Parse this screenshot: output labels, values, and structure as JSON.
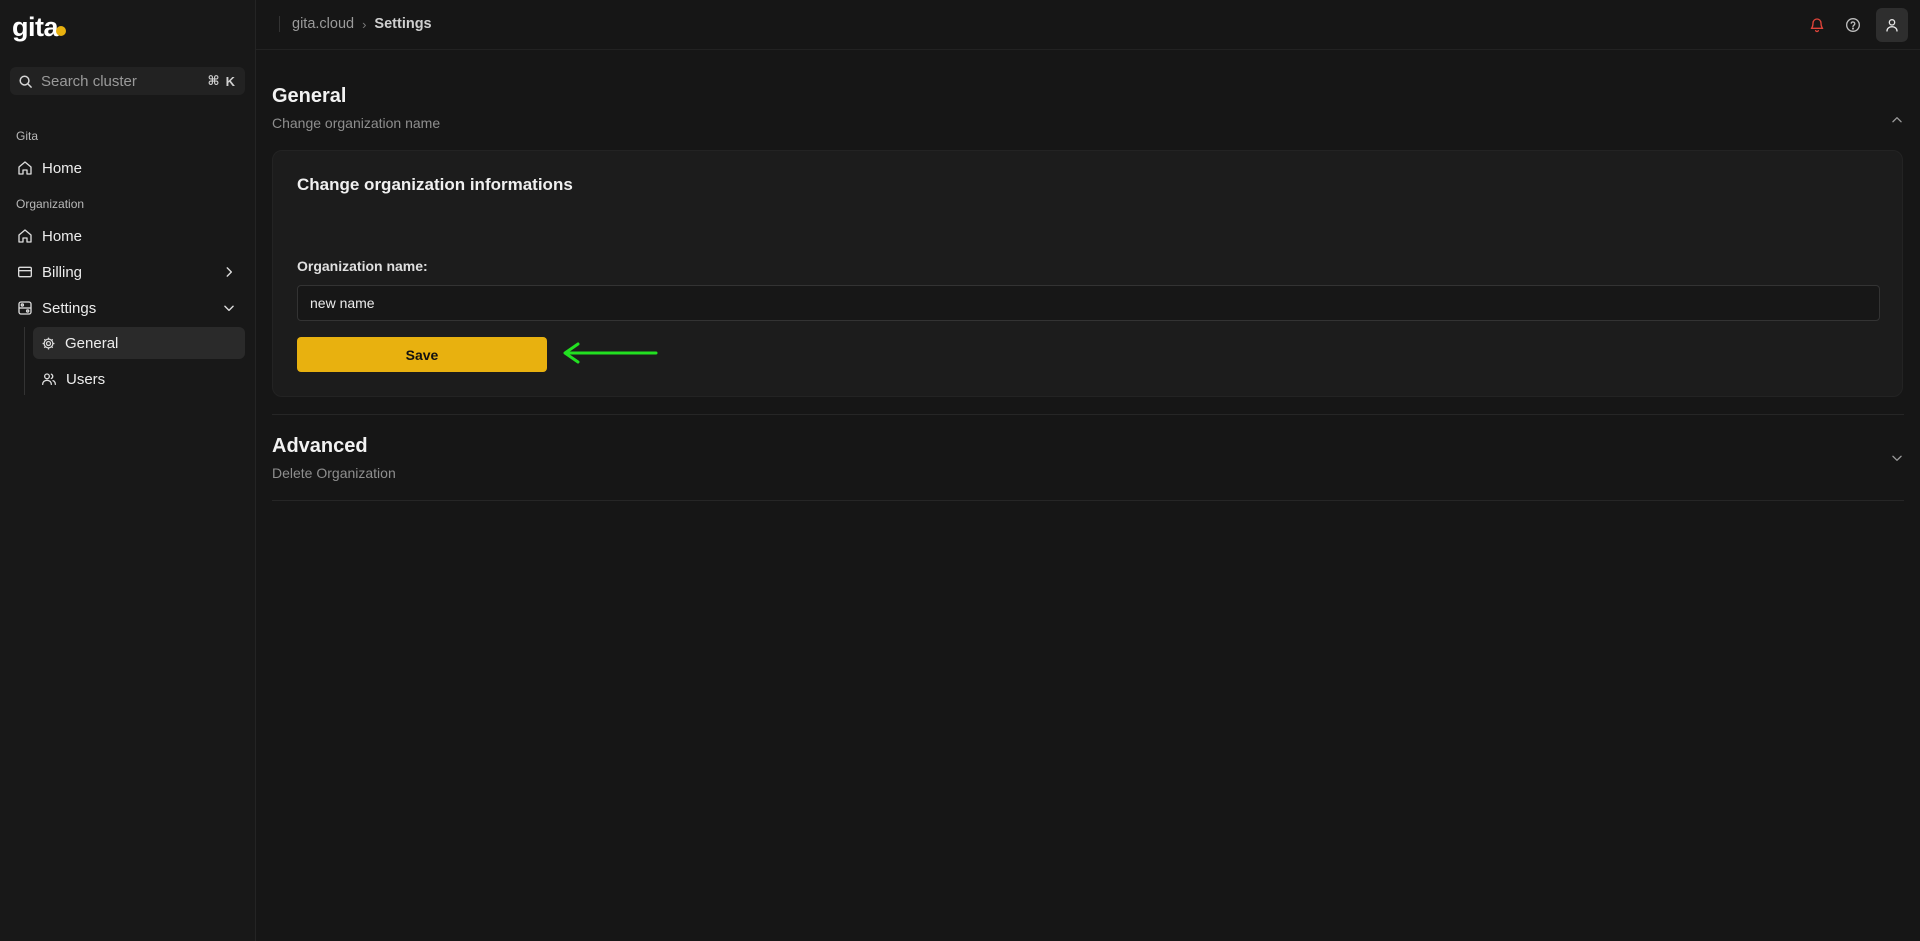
{
  "logo": {
    "text": "gita"
  },
  "search": {
    "placeholder": "Search cluster",
    "shortcut_symbol": "⌘",
    "shortcut_key": "K"
  },
  "sidebar": {
    "group_gita": "Gita",
    "gita_home": "Home",
    "group_org": "Organization",
    "org_home": "Home",
    "billing": "Billing",
    "settings": "Settings",
    "sub_general": "General",
    "sub_users": "Users"
  },
  "breadcrumb": {
    "root": "gita.cloud",
    "separator": "›",
    "current": "Settings"
  },
  "sections": {
    "general": {
      "title": "General",
      "subtitle": "Change organization name",
      "expanded": true
    },
    "advanced": {
      "title": "Advanced",
      "subtitle": "Delete Organization",
      "expanded": false
    }
  },
  "card": {
    "title": "Change organization informations",
    "field_label": "Organization name:",
    "field_value": "new name",
    "save_label": "Save"
  },
  "colors": {
    "accent": "#e8b10f",
    "background": "#161616",
    "notification": "#e0443a",
    "annotation_arrow": "#22e021"
  },
  "icons": [
    "search-icon",
    "home-icon",
    "billing-card-icon",
    "settings-icon",
    "gear-icon",
    "users-icon",
    "chevron-right-icon",
    "chevron-down-icon",
    "chevron-up-icon",
    "bell-icon",
    "help-icon",
    "user-icon"
  ]
}
